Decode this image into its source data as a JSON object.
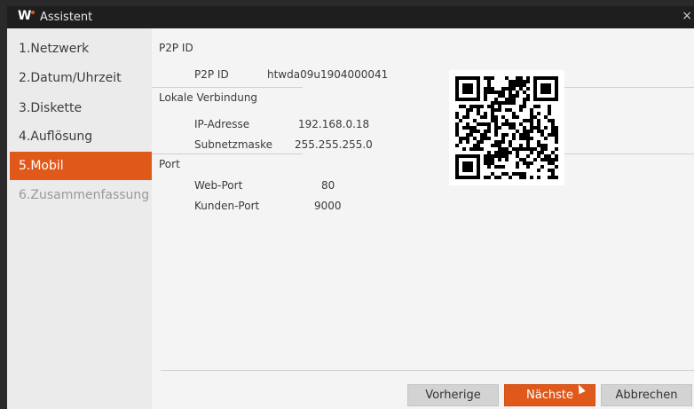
{
  "window": {
    "title": "Assistent",
    "logo_text": "W",
    "close_glyph": "×"
  },
  "sidebar": {
    "items": [
      {
        "label": "1.Netzwerk",
        "state": "normal"
      },
      {
        "label": "2.Datum/Uhrzeit",
        "state": "normal"
      },
      {
        "label": "3.Diskette",
        "state": "normal"
      },
      {
        "label": "4.Auflösung",
        "state": "normal"
      },
      {
        "label": "5.Mobil",
        "state": "active"
      },
      {
        "label": "6.Zusammenfassung",
        "state": "disabled"
      }
    ]
  },
  "main": {
    "p2p": {
      "header": "P2P ID",
      "label": "P2P ID",
      "value": "htwda09u1904000041"
    },
    "local": {
      "header": "Lokale Verbindung",
      "ip_label": "IP-Adresse",
      "ip_value": "192.168.0.18",
      "mask_label": "Subnetzmaske",
      "mask_value": "255.255.255.0"
    },
    "port": {
      "header": "Port",
      "web_label": "Web-Port",
      "web_value": "80",
      "client_label": "Kunden-Port",
      "client_value": "9000"
    }
  },
  "footer": {
    "prev": "Vorherige",
    "next": "Nächste",
    "cancel": "Abbrechen"
  },
  "colors": {
    "accent": "#e0591b",
    "titlebar": "#1e1e1e",
    "panel": "#f4f4f4"
  }
}
